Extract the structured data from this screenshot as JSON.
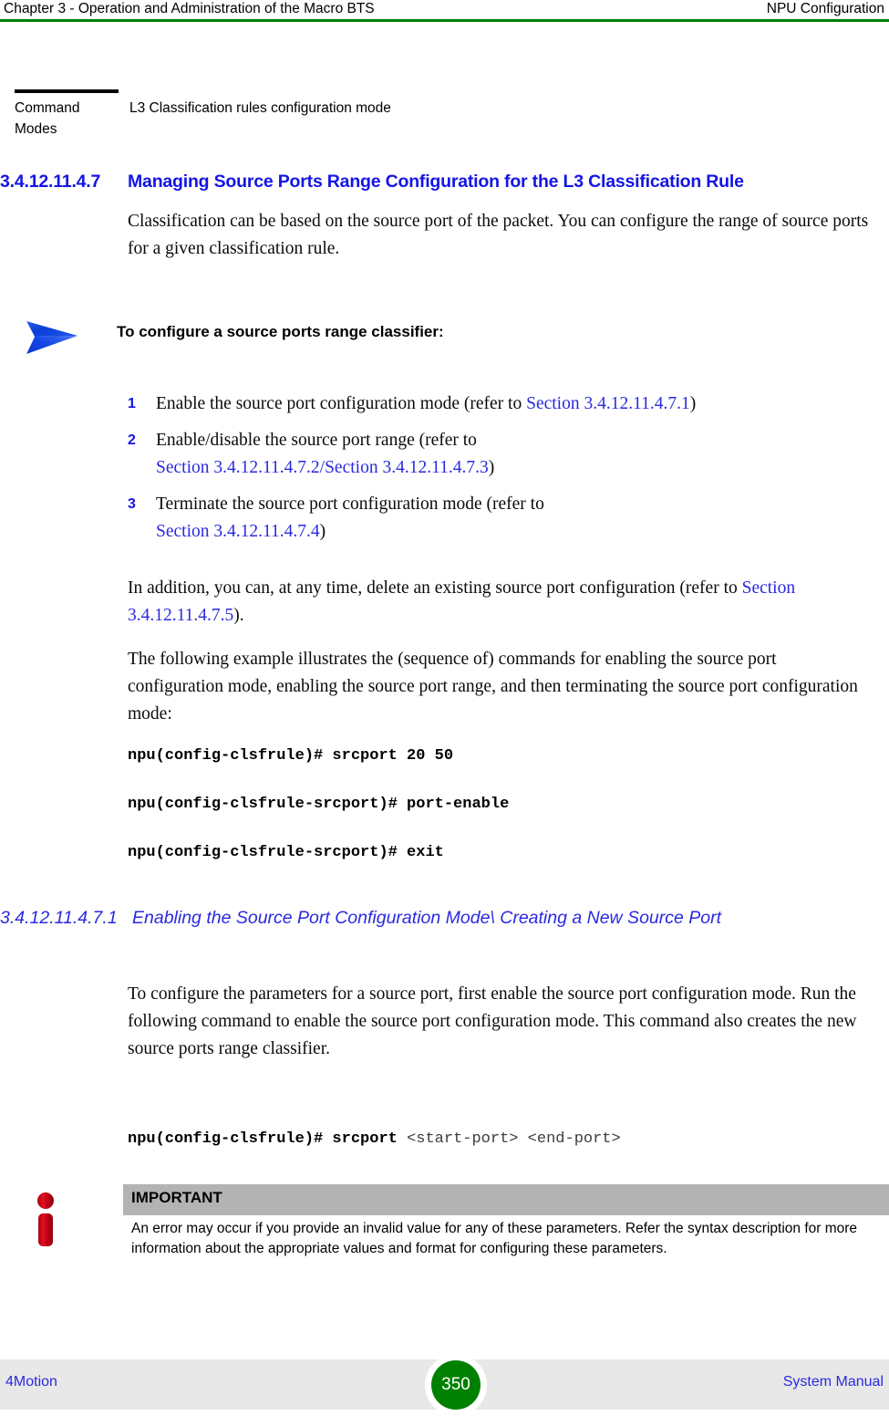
{
  "header": {
    "left": "Chapter 3 - Operation and Administration of the Macro BTS",
    "right": "NPU Configuration",
    "rule_color": "#008000"
  },
  "command_modes": {
    "label": "Command Modes",
    "value": "L3 Classification rules configuration mode"
  },
  "section": {
    "number": "3.4.12.11.4.7",
    "title": "Managing Source Ports Range Configuration for the L3 Classification Rule",
    "color": "#1414e6",
    "lead_paragraph": "Classification can be based on the source port of the packet. You can configure the range of source ports for a given classification rule."
  },
  "procedure": {
    "icon": "blue-arrow-icon",
    "title": "To configure a source ports range classifier:",
    "steps": [
      {
        "number": "1",
        "prefix": "Enable the source port configuration mode (refer to ",
        "link1": "Section 3.4.12.11.4.7.1",
        "middle": "",
        "link2": "",
        "suffix": ")"
      },
      {
        "number": "2",
        "prefix": "Enable/disable the source port range (refer to ",
        "link1": "Section 3.4.12.11.4.7.2",
        "middle": "/",
        "link2": "Section 3.4.12.11.4.7.3",
        "suffix": ")"
      },
      {
        "number": "3",
        "prefix": "Terminate the source port configuration mode (refer to ",
        "link1": "Section 3.4.12.11.4.7.4",
        "middle": "",
        "link2": "",
        "suffix": ")"
      }
    ]
  },
  "addition_paragraph": {
    "prefix": "In addition, you can, at any time, delete an existing source port configuration (refer to ",
    "link": "Section 3.4.12.11.4.7.5",
    "suffix": ")."
  },
  "example_paragraph": "The following example illustrates the (sequence of) commands for enabling the source port configuration mode, enabling the source port range, and then terminating the source port configuration mode:",
  "cli_example": {
    "line1": "npu(config-clsfrule)# srcport 20 50",
    "line2": "npu(config-clsfrule-srcport)# port-enable",
    "line3": "npu(config-clsfrule-srcport)# exit"
  },
  "subsection": {
    "number": "3.4.12.11.4.7.1",
    "title": "Enabling the Source Port Configuration Mode\\ Creating a New Source Port",
    "color": "#2a2ae0",
    "paragraph": "To configure the parameters for a source port, first enable the source port configuration mode. Run the following command to enable the source port configuration mode. This command also creates the new source ports range classifier."
  },
  "cli_syntax": {
    "command": "npu(config-clsfrule)# srcport ",
    "placeholders": "<start-port> <end-port>"
  },
  "note": {
    "icon": "red-info-icon",
    "title": "IMPORTANT",
    "bar_color": "#b3b3b3",
    "body": "An error may occur if you provide an invalid value for any of these parameters. Refer the syntax description for more information about the appropriate values and format for configuring these parameters."
  },
  "footer": {
    "left": "4Motion",
    "right": "System Manual",
    "page_number": "350",
    "badge_color": "#008000"
  }
}
